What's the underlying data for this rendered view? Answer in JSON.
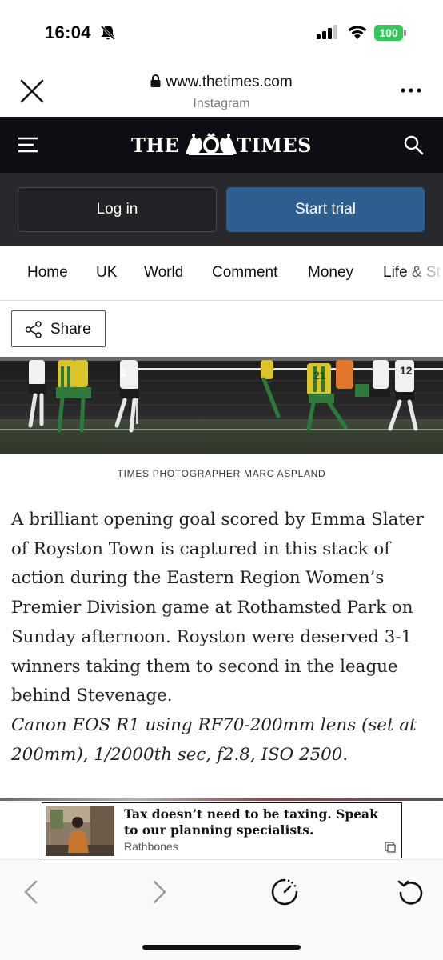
{
  "status_bar": {
    "time": "16:04",
    "battery_level": "100",
    "icons": [
      "bell-slash-icon",
      "signal-icon",
      "wifi-icon",
      "battery-icon"
    ]
  },
  "browser": {
    "url": "www.thetimes.com",
    "source": "Instagram",
    "icons": [
      "close-icon",
      "lock-icon",
      "more-icon"
    ]
  },
  "masthead": {
    "logo_left": "THE",
    "logo_right": "TIMES",
    "icons": [
      "menu-icon",
      "crest-icon",
      "search-icon"
    ]
  },
  "auth": {
    "login_label": "Log in",
    "trial_label": "Start trial"
  },
  "nav": {
    "items": [
      {
        "label": "Home"
      },
      {
        "label": "UK"
      },
      {
        "label": "World"
      },
      {
        "label": "Comment"
      },
      {
        "label": "Money"
      },
      {
        "label": "Life & St"
      }
    ]
  },
  "share": {
    "label": "Share",
    "icon": "share-icon"
  },
  "photo": {
    "caption": "TIMES PHOTOGRAPHER MARC ASPLAND"
  },
  "article": {
    "body": "A brilliant opening goal scored by Emma Slater of Royston Town is captured in this stack of action during the Eastern Region Women’s Premier Division game at Rothamsted Park on Sunday afternoon. Royston were deserved 3-1 winners taking them to second in the league behind Stevenage.",
    "camera_details": "Canon EOS R1 using RF70-200mm lens (set at 200mm), 1/2000th sec, f2.8, ISO 2500."
  },
  "ad": {
    "headline": "Tax doesn’t need to be taxing. Speak to our planning specialists.",
    "brand": "Rathbones",
    "icon": "ad-choices-icon"
  },
  "toolbar": {
    "icons": [
      "back-icon",
      "forward-icon",
      "speed-icon",
      "reload-icon"
    ]
  },
  "colors": {
    "masthead_bg": "#0c0e14",
    "auth_bg": "#28292d",
    "trial_button": "#2d5e8f",
    "battery": "#34c759"
  }
}
